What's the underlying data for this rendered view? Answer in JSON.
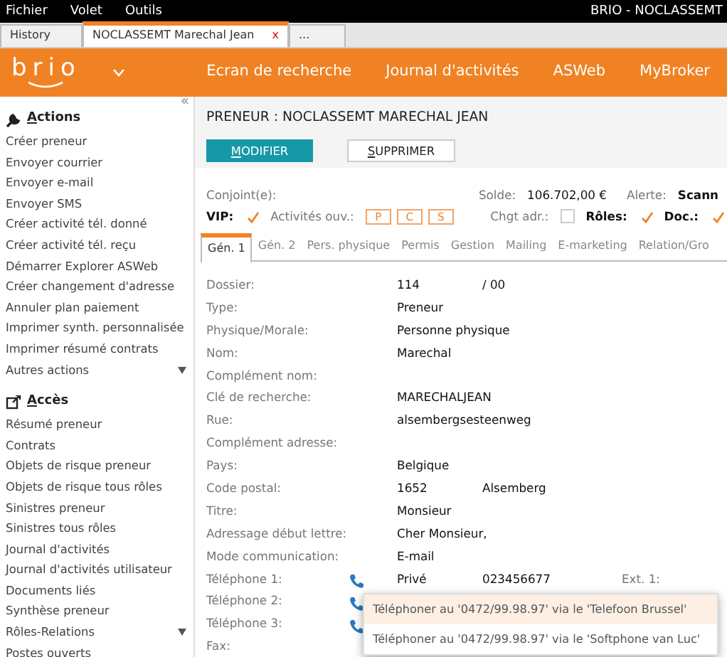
{
  "menu_bar": {
    "items": [
      "Fichier",
      "Volet",
      "Outils"
    ],
    "title": "BRIO - NOCLASSEMT"
  },
  "doc_tabs": [
    {
      "label": "History",
      "selected": false,
      "closable": false
    },
    {
      "label": "NOCLASSEMT Marechal Jean",
      "selected": true,
      "closable": true,
      "close": "x"
    },
    {
      "label": "...",
      "selected": false,
      "closable": false
    }
  ],
  "header": {
    "logo": "brio",
    "nav": [
      "Ecran de recherche",
      "Journal d'activités",
      "ASWeb",
      "MyBroker"
    ]
  },
  "sidebar": {
    "collapse": "«",
    "sections": [
      {
        "title": "Actions",
        "kind": "wrench",
        "items": [
          {
            "label": "Créer preneur",
            "more": false
          },
          {
            "label": "Envoyer courrier",
            "more": false
          },
          {
            "label": "Envoyer e-mail",
            "more": false
          },
          {
            "label": "Envoyer SMS",
            "more": false
          },
          {
            "label": "Créer activité tél. donné",
            "more": false
          },
          {
            "label": "Créer activité tél. reçu",
            "more": false
          },
          {
            "label": "Démarrer Explorer ASWeb",
            "more": false
          },
          {
            "label": "Créer changement d'adresse",
            "more": false
          },
          {
            "label": "Annuler plan paiement",
            "more": false
          },
          {
            "label": "Imprimer synth. personnalisée",
            "more": false
          },
          {
            "label": "Imprimer résumé contrats",
            "more": false
          },
          {
            "label": "Autres actions",
            "more": true
          }
        ]
      },
      {
        "title": "Accès",
        "kind": "link",
        "items": [
          {
            "label": "Résumé preneur",
            "more": false
          },
          {
            "label": "Contrats",
            "more": false
          },
          {
            "label": "Objets de risque preneur",
            "more": false
          },
          {
            "label": "Objets de risque tous rôles",
            "more": false
          },
          {
            "label": "Sinistres preneur",
            "more": false
          },
          {
            "label": "Sinistres tous rôles",
            "more": false
          },
          {
            "label": "Journal d'activités",
            "more": false
          },
          {
            "label": "Journal d'activités utilisateur",
            "more": false
          },
          {
            "label": "Documents liés",
            "more": false
          },
          {
            "label": "Synthèse preneur",
            "more": false
          },
          {
            "label": "Rôles-Relations",
            "more": true
          },
          {
            "label": "Postes ouverts",
            "more": false
          }
        ]
      }
    ]
  },
  "record": {
    "title": "PRENEUR : NOCLASSEMT MARECHAL JEAN",
    "buttons": [
      {
        "label": "MODIFIER",
        "primary": true
      },
      {
        "label": "SUPPRIMER",
        "primary": false
      }
    ],
    "conjoint": "Conjoint(e):",
    "solde_label": "Solde:",
    "solde": "106.702,00 €",
    "alerte_label": "Alerte:",
    "alerte": "Scann",
    "flags": [
      {
        "kind": "checkbox",
        "label": "VIP:",
        "checked": true,
        "bold": true
      },
      {
        "kind": "boxes",
        "label": "Activités ouv.:",
        "boxes": [
          "P",
          "C",
          "S"
        ]
      },
      {
        "kind": "checkbox",
        "label": "Chgt adr.:",
        "checked": false,
        "bold": false
      },
      {
        "kind": "checkbox",
        "label": "Rôles:",
        "checked": true,
        "bold": true
      },
      {
        "kind": "checkbox",
        "label": "Doc.:",
        "checked": true,
        "bold": true
      }
    ],
    "tabs": [
      {
        "label": "Gén. 1",
        "selected": true
      },
      {
        "label": "Gén. 2",
        "selected": false
      },
      {
        "label": "Pers. physique",
        "selected": false
      },
      {
        "label": "Permis",
        "selected": false
      },
      {
        "label": "Gestion",
        "selected": false
      },
      {
        "label": "Mailing",
        "selected": false
      },
      {
        "label": "E-marketing",
        "selected": false
      },
      {
        "label": "Relation/Gro",
        "selected": false
      }
    ],
    "fields": [
      {
        "label": "Dossier:",
        "value": "114",
        "value_2": "/ 00"
      },
      {
        "label": "Type:",
        "value": "Preneur"
      },
      {
        "label": "Physique/Morale:",
        "value": "Personne physique"
      },
      {
        "label": "Nom:",
        "value": "Marechal"
      },
      {
        "label": "Complément nom:"
      },
      {
        "label": "Clé de recherche:",
        "value": "MARECHALJEAN"
      },
      {
        "label": "Rue:",
        "value": "alsembergsesteenweg"
      },
      {
        "label": "Complément adresse:"
      },
      {
        "label": "Pays:",
        "value": "Belgique"
      },
      {
        "label": "Code postal:",
        "value": "1652",
        "value_2": "Alsemberg"
      },
      {
        "label": "Titre:",
        "value": "Monsieur"
      },
      {
        "label": "Adressage début lettre:",
        "value": "Cher Monsieur,"
      },
      {
        "label": "Mode communication:",
        "value": "E-mail"
      },
      {
        "label": "Téléphone 1:",
        "phone": true,
        "value": "Privé",
        "value_2": "023456677",
        "value_3": "Ext. 1:"
      },
      {
        "label": "Téléphone 2:",
        "phone": true
      },
      {
        "label": "Téléphone 3:",
        "phone": true
      },
      {
        "label": "Fax:"
      }
    ],
    "popup": [
      {
        "label": "Téléphoner au '0472/99.98.97' via le 'Telefoon Brussel'",
        "selected": true
      },
      {
        "label": "Téléphoner au '0472/99.98.97' via le 'Softphone van Luc'",
        "selected": false
      }
    ]
  }
}
